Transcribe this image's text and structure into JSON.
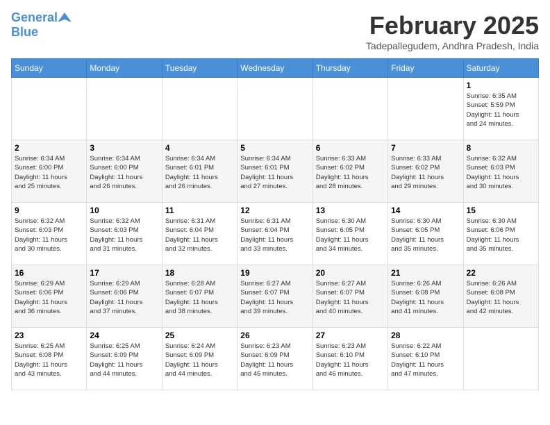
{
  "header": {
    "logo_line1": "General",
    "logo_line2": "Blue",
    "month": "February 2025",
    "location": "Tadepallegudem, Andhra Pradesh, India"
  },
  "days_of_week": [
    "Sunday",
    "Monday",
    "Tuesday",
    "Wednesday",
    "Thursday",
    "Friday",
    "Saturday"
  ],
  "weeks": [
    [
      {
        "day": "",
        "info": ""
      },
      {
        "day": "",
        "info": ""
      },
      {
        "day": "",
        "info": ""
      },
      {
        "day": "",
        "info": ""
      },
      {
        "day": "",
        "info": ""
      },
      {
        "day": "",
        "info": ""
      },
      {
        "day": "1",
        "info": "Sunrise: 6:35 AM\nSunset: 5:59 PM\nDaylight: 11 hours\nand 24 minutes."
      }
    ],
    [
      {
        "day": "2",
        "info": "Sunrise: 6:34 AM\nSunset: 6:00 PM\nDaylight: 11 hours\nand 25 minutes."
      },
      {
        "day": "3",
        "info": "Sunrise: 6:34 AM\nSunset: 6:00 PM\nDaylight: 11 hours\nand 26 minutes."
      },
      {
        "day": "4",
        "info": "Sunrise: 6:34 AM\nSunset: 6:01 PM\nDaylight: 11 hours\nand 26 minutes."
      },
      {
        "day": "5",
        "info": "Sunrise: 6:34 AM\nSunset: 6:01 PM\nDaylight: 11 hours\nand 27 minutes."
      },
      {
        "day": "6",
        "info": "Sunrise: 6:33 AM\nSunset: 6:02 PM\nDaylight: 11 hours\nand 28 minutes."
      },
      {
        "day": "7",
        "info": "Sunrise: 6:33 AM\nSunset: 6:02 PM\nDaylight: 11 hours\nand 29 minutes."
      },
      {
        "day": "8",
        "info": "Sunrise: 6:32 AM\nSunset: 6:03 PM\nDaylight: 11 hours\nand 30 minutes."
      }
    ],
    [
      {
        "day": "9",
        "info": "Sunrise: 6:32 AM\nSunset: 6:03 PM\nDaylight: 11 hours\nand 30 minutes."
      },
      {
        "day": "10",
        "info": "Sunrise: 6:32 AM\nSunset: 6:03 PM\nDaylight: 11 hours\nand 31 minutes."
      },
      {
        "day": "11",
        "info": "Sunrise: 6:31 AM\nSunset: 6:04 PM\nDaylight: 11 hours\nand 32 minutes."
      },
      {
        "day": "12",
        "info": "Sunrise: 6:31 AM\nSunset: 6:04 PM\nDaylight: 11 hours\nand 33 minutes."
      },
      {
        "day": "13",
        "info": "Sunrise: 6:30 AM\nSunset: 6:05 PM\nDaylight: 11 hours\nand 34 minutes."
      },
      {
        "day": "14",
        "info": "Sunrise: 6:30 AM\nSunset: 6:05 PM\nDaylight: 11 hours\nand 35 minutes."
      },
      {
        "day": "15",
        "info": "Sunrise: 6:30 AM\nSunset: 6:06 PM\nDaylight: 11 hours\nand 35 minutes."
      }
    ],
    [
      {
        "day": "16",
        "info": "Sunrise: 6:29 AM\nSunset: 6:06 PM\nDaylight: 11 hours\nand 36 minutes."
      },
      {
        "day": "17",
        "info": "Sunrise: 6:29 AM\nSunset: 6:06 PM\nDaylight: 11 hours\nand 37 minutes."
      },
      {
        "day": "18",
        "info": "Sunrise: 6:28 AM\nSunset: 6:07 PM\nDaylight: 11 hours\nand 38 minutes."
      },
      {
        "day": "19",
        "info": "Sunrise: 6:27 AM\nSunset: 6:07 PM\nDaylight: 11 hours\nand 39 minutes."
      },
      {
        "day": "20",
        "info": "Sunrise: 6:27 AM\nSunset: 6:07 PM\nDaylight: 11 hours\nand 40 minutes."
      },
      {
        "day": "21",
        "info": "Sunrise: 6:26 AM\nSunset: 6:08 PM\nDaylight: 11 hours\nand 41 minutes."
      },
      {
        "day": "22",
        "info": "Sunrise: 6:26 AM\nSunset: 6:08 PM\nDaylight: 11 hours\nand 42 minutes."
      }
    ],
    [
      {
        "day": "23",
        "info": "Sunrise: 6:25 AM\nSunset: 6:08 PM\nDaylight: 11 hours\nand 43 minutes."
      },
      {
        "day": "24",
        "info": "Sunrise: 6:25 AM\nSunset: 6:09 PM\nDaylight: 11 hours\nand 44 minutes."
      },
      {
        "day": "25",
        "info": "Sunrise: 6:24 AM\nSunset: 6:09 PM\nDaylight: 11 hours\nand 44 minutes."
      },
      {
        "day": "26",
        "info": "Sunrise: 6:23 AM\nSunset: 6:09 PM\nDaylight: 11 hours\nand 45 minutes."
      },
      {
        "day": "27",
        "info": "Sunrise: 6:23 AM\nSunset: 6:10 PM\nDaylight: 11 hours\nand 46 minutes."
      },
      {
        "day": "28",
        "info": "Sunrise: 6:22 AM\nSunset: 6:10 PM\nDaylight: 11 hours\nand 47 minutes."
      },
      {
        "day": "",
        "info": ""
      }
    ]
  ]
}
